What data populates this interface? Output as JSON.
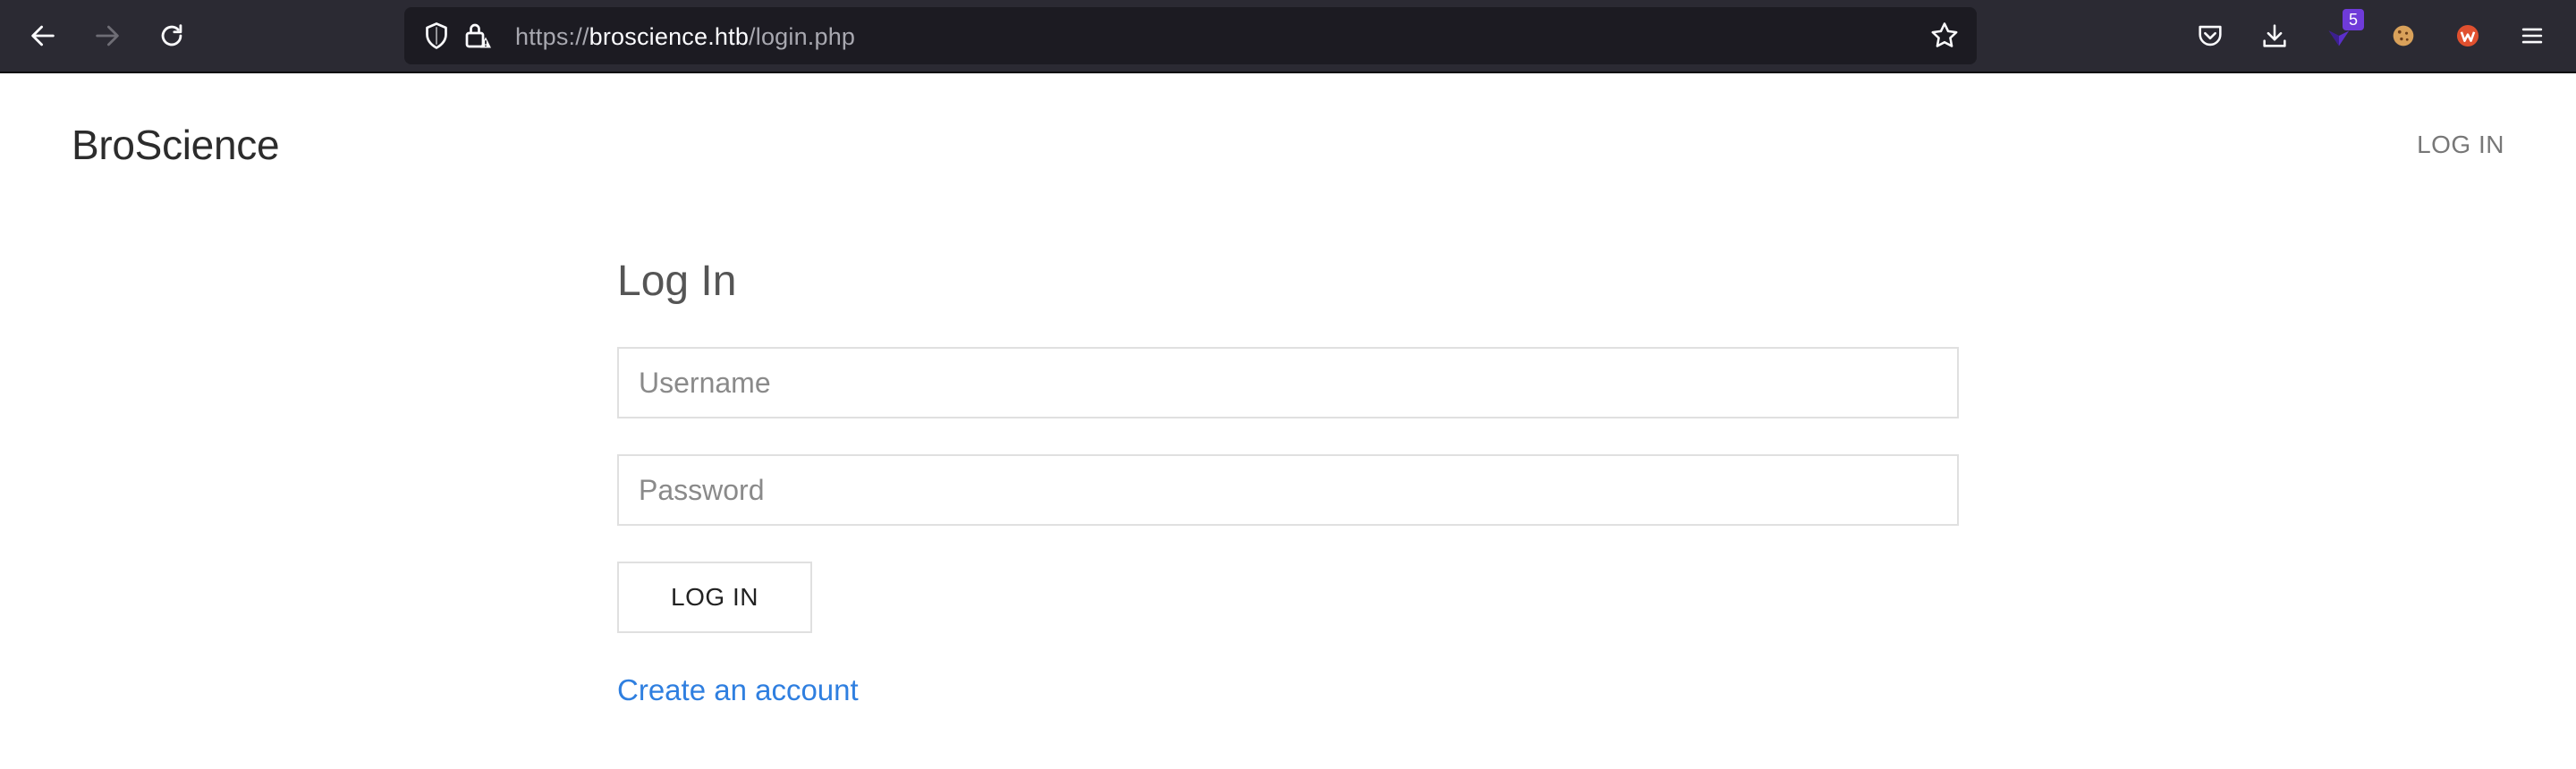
{
  "browser": {
    "url_scheme": "https://",
    "url_host": "broscience.htb",
    "url_path": "/login.php",
    "extension_badge": "5",
    "icon_color": "#fbfbfe",
    "toolbar_bg": "#2b2a33"
  },
  "page": {
    "brand": "BroScience",
    "nav_login": "LOG IN",
    "heading": "Log In",
    "username_placeholder": "Username",
    "password_placeholder": "Password",
    "login_button": "LOG IN",
    "create_account": "Create an account",
    "link_color": "#2f7fe0"
  }
}
